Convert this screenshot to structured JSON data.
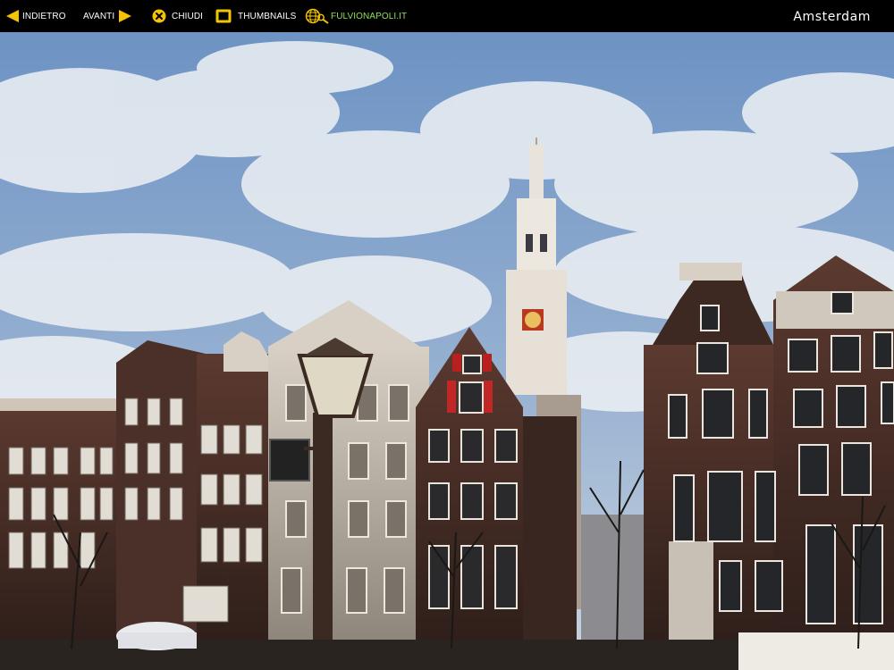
{
  "nav": {
    "back_label": "INDIETRO",
    "forward_label": "AVANTI",
    "close_label": "CHIUDI",
    "thumbnails_label": "THUMBNAILS",
    "site_label": "FULVIONAPOLI.IT",
    "back_icon": "arrow-left-icon",
    "forward_icon": "arrow-right-icon",
    "close_icon": "close-circle-icon",
    "thumbnails_icon": "square-icon",
    "site_icon": "globe-search-icon"
  },
  "photo": {
    "title": "Amsterdam"
  },
  "colors": {
    "background": "#000000",
    "accent": "#f5c400",
    "site_link": "#8fe05a",
    "text": "#ffffff"
  }
}
